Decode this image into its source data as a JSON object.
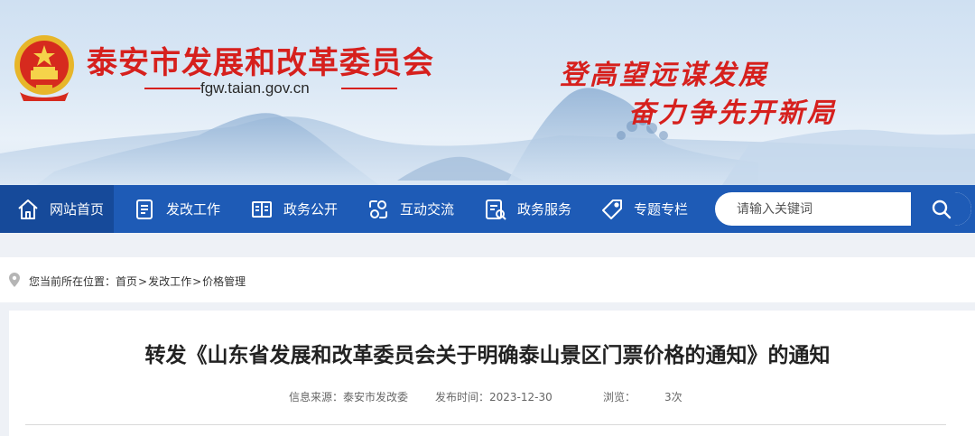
{
  "header": {
    "site_name": "泰安市发展和改革委员会",
    "domain": "fgw.taian.gov.cn",
    "slogan_line1": "登高望远谋发展",
    "slogan_line2": "奋力争先开新局",
    "brand_red": "#d6201d"
  },
  "nav": {
    "items": [
      {
        "label": "网站首页",
        "icon": "home-icon",
        "active": true
      },
      {
        "label": "发改工作",
        "icon": "document-list-icon"
      },
      {
        "label": "政务公开",
        "icon": "open-book-icon"
      },
      {
        "label": "互动交流",
        "icon": "interaction-icon"
      },
      {
        "label": "政务服务",
        "icon": "service-list-icon"
      },
      {
        "label": "专题专栏",
        "icon": "tag-icon"
      }
    ],
    "search_placeholder": "请输入关键词",
    "nav_color": "#1e5bb6"
  },
  "breadcrumb": {
    "prefix": "您当前所在位置：",
    "items": [
      "首页",
      "发改工作",
      "价格管理"
    ],
    "separator": ">"
  },
  "article": {
    "title": "转发《山东省发展和改革委员会关于明确泰山景区门票价格的通知》的通知",
    "source": "信息来源：泰安市发改委",
    "publish": "发布时间：2023-12-30",
    "views_label": "浏览：",
    "views": "3次"
  }
}
